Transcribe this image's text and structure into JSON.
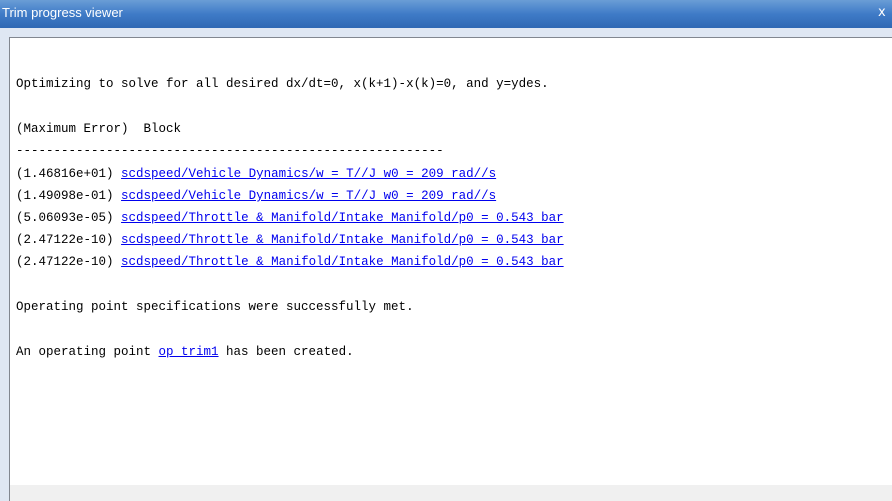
{
  "window": {
    "title": "Trim progress viewer",
    "close_label": "x"
  },
  "log": {
    "intro": "Optimizing to solve for all desired dx/dt=0, x(k+1)-x(k)=0, and y=ydes.",
    "header": "(Maximum Error)  Block",
    "separator": "---------------------------------------------------------",
    "rows": [
      {
        "error": "(1.46816e+01)",
        "block": "scdspeed/Vehicle Dynamics/w = T//J w0 = 209 rad//s"
      },
      {
        "error": "(1.49098e-01)",
        "block": "scdspeed/Vehicle Dynamics/w = T//J w0 = 209 rad//s"
      },
      {
        "error": "(5.06093e-05)",
        "block": "scdspeed/Throttle & Manifold/Intake Manifold/p0 = 0.543 bar"
      },
      {
        "error": "(2.47122e-10)",
        "block": "scdspeed/Throttle & Manifold/Intake Manifold/p0 = 0.543 bar"
      },
      {
        "error": "(2.47122e-10)",
        "block": "scdspeed/Throttle & Manifold/Intake Manifold/p0 = 0.543 bar"
      }
    ],
    "success": "Operating point specifications were successfully met.",
    "created_prefix": "An operating point ",
    "created_link": "op_trim1",
    "created_suffix": " has been created."
  },
  "colors": {
    "titlebar": "#3f7bc7",
    "link": "#0000ee",
    "frame": "#dfe7f3"
  }
}
